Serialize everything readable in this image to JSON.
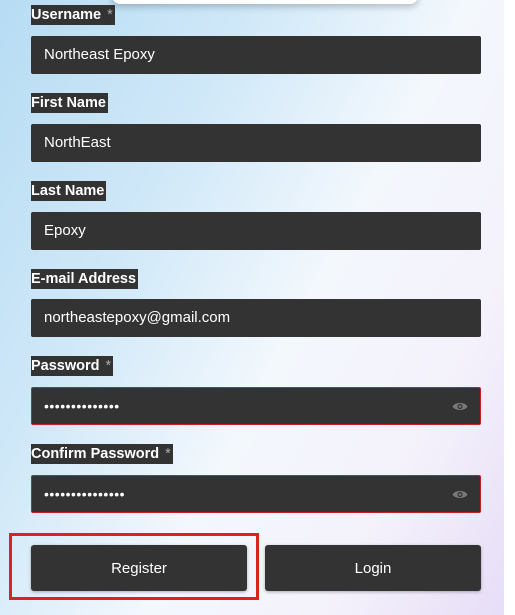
{
  "form": {
    "username": {
      "label": "Username",
      "required_mark": "*",
      "value": "Northeast Epoxy"
    },
    "first_name": {
      "label": "First Name",
      "value": "NorthEast"
    },
    "last_name": {
      "label": "Last Name",
      "value": "Epoxy"
    },
    "email": {
      "label": "E-mail Address",
      "value": "northeastepoxy@gmail.com"
    },
    "password": {
      "label": "Password",
      "required_mark": "*",
      "value": "••••••••••••••",
      "state": "error",
      "toggle_icon": "eye-icon"
    },
    "confirm_password": {
      "label": "Confirm Password",
      "required_mark": "*",
      "value": "•••••••••••••••",
      "state": "error",
      "toggle_icon": "eye-icon"
    }
  },
  "buttons": {
    "register_label": "Register",
    "login_label": "Login"
  },
  "colors": {
    "field_bg": "#333333",
    "error_border": "#c81e28",
    "highlight": "#d9231d"
  }
}
